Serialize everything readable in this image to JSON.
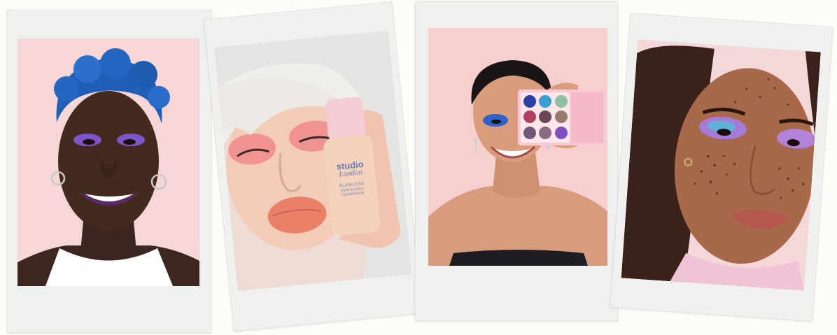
{
  "photos": [
    {
      "subject": "woman with blue short hair and purple lipstick",
      "eyeshadow": "purple",
      "background": "#f6d6d7"
    },
    {
      "subject": "woman with platinum bangs holding foundation bottle",
      "eyeshadow": "coral-pink",
      "background": "#eddcd6"
    },
    {
      "subject": "woman holding eyeshadow palette over eye",
      "eyeshadow": "blue",
      "background": "#f7cfcf"
    },
    {
      "subject": "woman with freckles and iridescent eyeshadow",
      "eyeshadow": "iridescent violet",
      "background": "#f5d7d9"
    }
  ],
  "product": {
    "brand_line1": "studio",
    "brand_line2": "London",
    "name_line1": "FLAWLESS",
    "name_line2": "PERFECTING",
    "name_line3": "FOUNDATION"
  },
  "palette_colors": [
    "#2b3fa6",
    "#3a9ed0",
    "#8fbfa4",
    "#b24060",
    "#6a4658",
    "#9a7a6c",
    "#6e5a78",
    "#8a6a80",
    "#7e4fc3"
  ]
}
